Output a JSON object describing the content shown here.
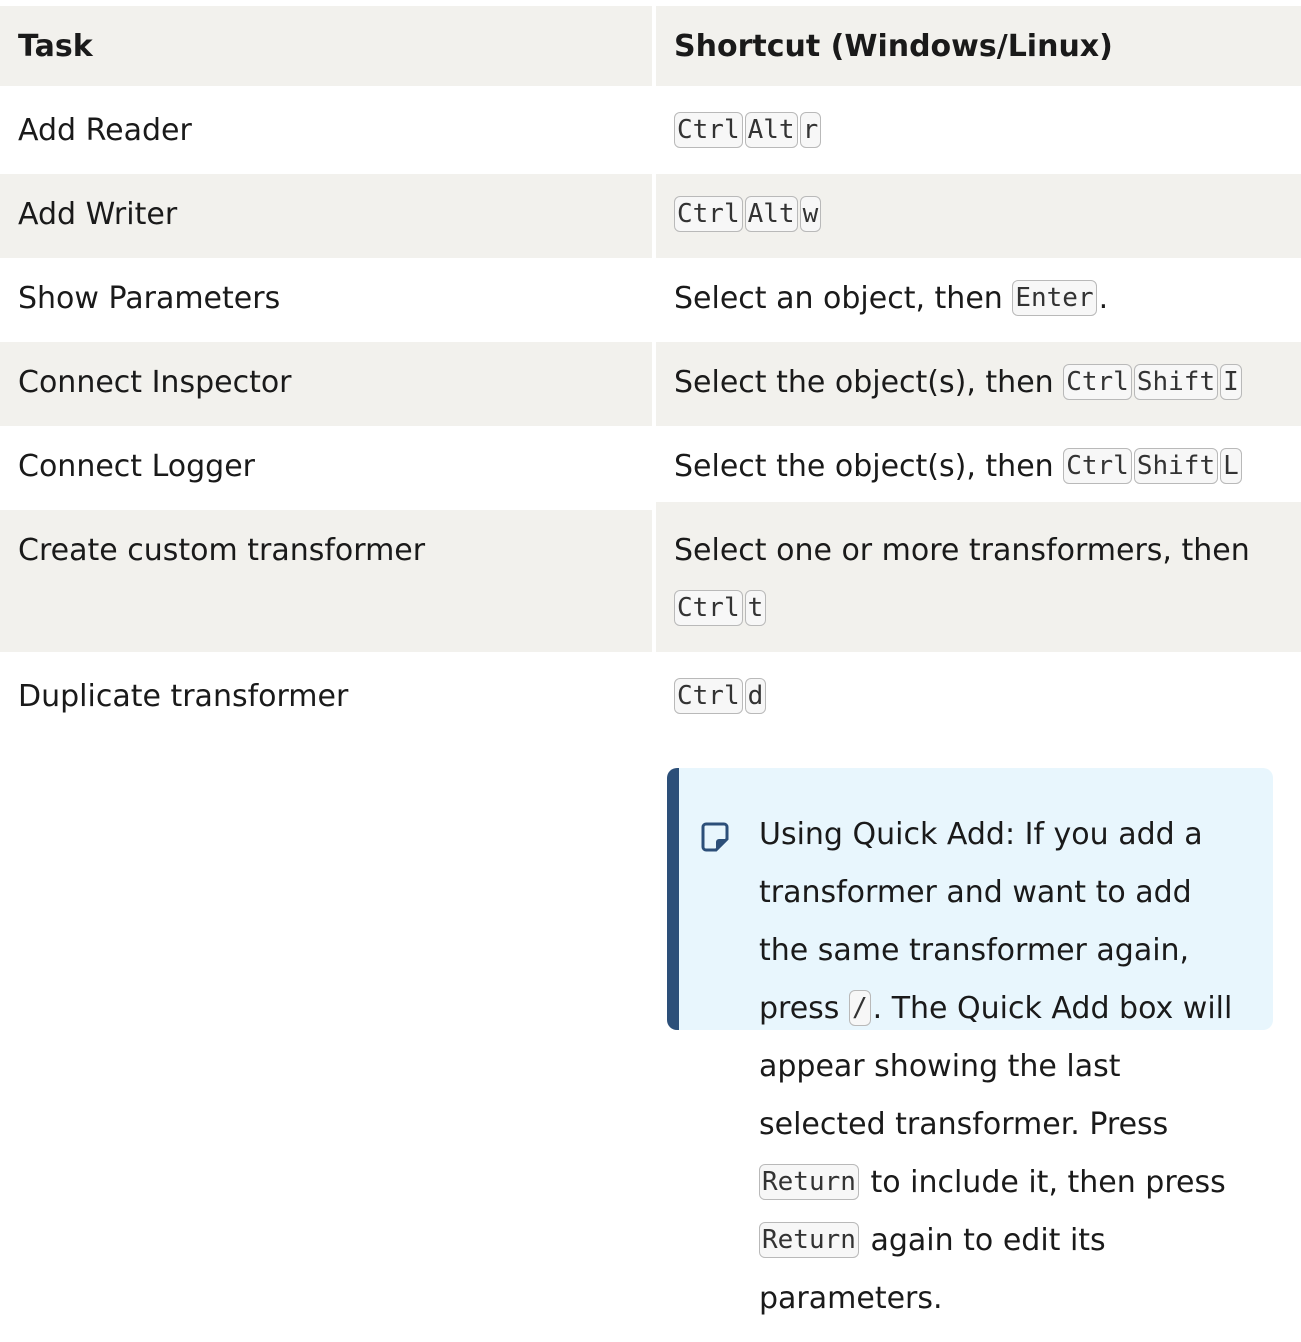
{
  "table": {
    "headers": {
      "task": "Task",
      "shortcut": "Shortcut (Windows/Linux)"
    },
    "rows": [
      {
        "task": "Add Reader",
        "pre": "",
        "keys": [
          "Ctrl",
          "Alt",
          "r"
        ],
        "post": ""
      },
      {
        "task": "Add Writer",
        "pre": "",
        "keys": [
          "Ctrl",
          "Alt",
          "w"
        ],
        "post": ""
      },
      {
        "task": "Show Parameters",
        "pre": "Select an object, then",
        "keys": [
          "Enter"
        ],
        "post": "."
      },
      {
        "task": "Connect Inspector",
        "pre": "Select the object(s), then",
        "keys": [
          "Ctrl",
          "Shift",
          "I"
        ],
        "post": ""
      },
      {
        "task": "Connect Logger",
        "pre": "Select the object(s), then",
        "keys": [
          "Ctrl",
          "Shift",
          "L"
        ],
        "post": ""
      },
      {
        "task": "Create custom transformer",
        "pre": "Select one or more transformers, then",
        "keys": [
          "Ctrl",
          "t"
        ],
        "post": ""
      },
      {
        "task": "Duplicate transformer",
        "pre": "",
        "keys": [
          "Ctrl",
          "d"
        ],
        "post": ""
      }
    ]
  },
  "note": {
    "icon": "note-icon",
    "part1": "Using Quick Add: If you add a transformer and want to add the same transformer again, press",
    "key1": "/",
    "part2": ". The Quick Add box will appear showing the last selected transformer. Press",
    "key2": "Return",
    "part3": "to include it, then press",
    "key3": "Return",
    "part4": "again to edit its parameters.",
    "accent_color": "#2c4f79",
    "background_color": "#e8f6fd"
  }
}
